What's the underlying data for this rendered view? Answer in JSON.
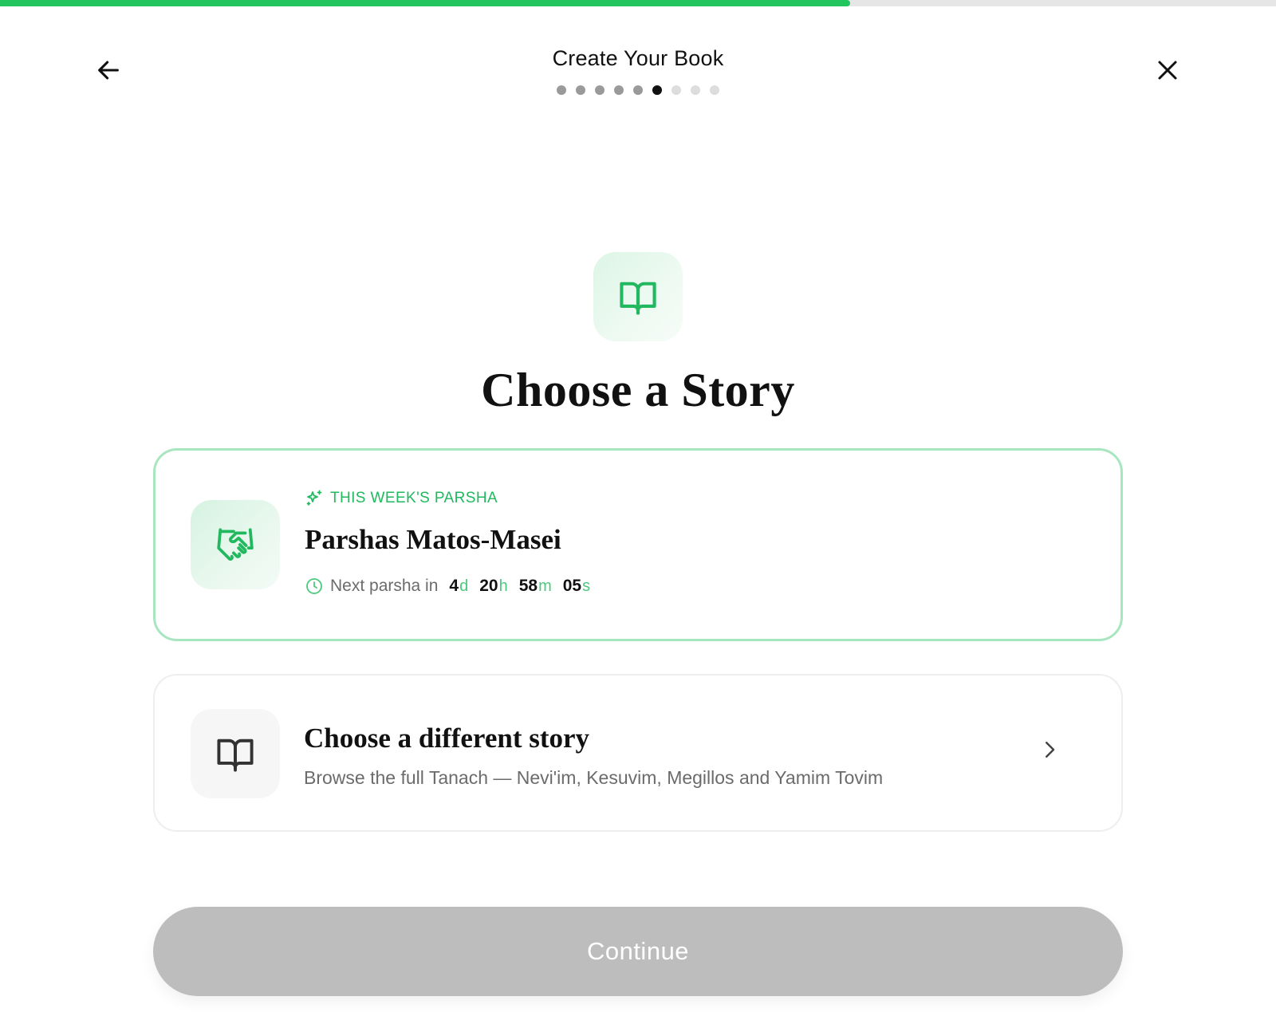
{
  "progress": {
    "value": 0.666
  },
  "header": {
    "title": "Create Your Book",
    "steps": {
      "total": 9,
      "current": 6
    }
  },
  "hero": {
    "title": "Choose a Story",
    "icon": "open-book-icon"
  },
  "parsha_card": {
    "badge": "THIS WEEK'S PARSHA",
    "title": "Parshas Matos-Masei",
    "countdown_label": "Next parsha in",
    "countdown": {
      "days": "4",
      "days_suffix": "d",
      "hours": "20",
      "hours_suffix": "h",
      "minutes": "58",
      "minutes_suffix": "m",
      "seconds": "05",
      "seconds_suffix": "s"
    },
    "icon": "handshake-icon"
  },
  "other_card": {
    "title": "Choose a different story",
    "subtitle": "Browse the full Tanach — Nevi'im, Kesuvim, Megillos and Yamim Tovim",
    "icon": "open-book-icon"
  },
  "continue_label": "Continue",
  "colors": {
    "accent": "#22c55e",
    "accent_border": "#a8e6bf",
    "disabled_button": "#bdbdbd"
  }
}
